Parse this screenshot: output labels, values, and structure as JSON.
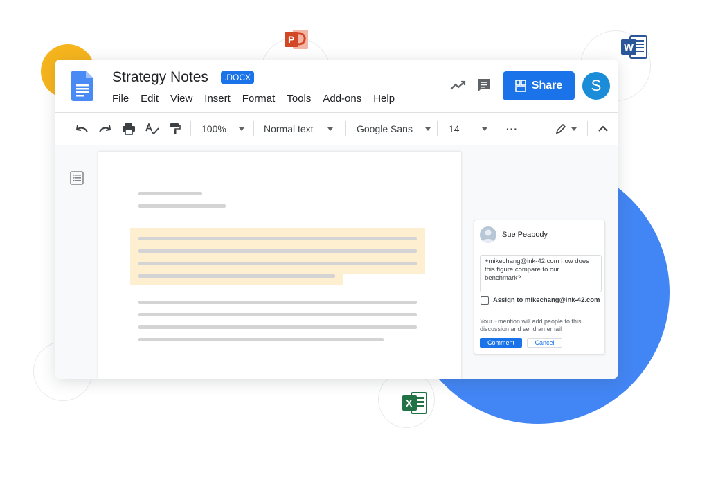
{
  "app": {
    "title": "Strategy Notes",
    "badge": ".DOCX",
    "menu": [
      "File",
      "Edit",
      "View",
      "Insert",
      "Format",
      "Tools",
      "Add-ons",
      "Help"
    ],
    "share_label": "Share",
    "avatar_initial": "S"
  },
  "toolbar": {
    "zoom": "100%",
    "style": "Normal text",
    "font": "Google Sans",
    "size": "14",
    "more": "···"
  },
  "comment": {
    "author": "Sue Peabody",
    "text": "+mikechang@ink-42.com how does this figure compare to our benchmark?",
    "assign_label": "Assign to mikechang@ink-42.com",
    "note": "Your +mention will add people to this discussion and send an email",
    "comment_button": "Comment",
    "cancel_button": "Cancel"
  },
  "deco_icons": {
    "powerpoint": "P",
    "word": "W",
    "excel": "X"
  },
  "colors": {
    "accent_blue": "#1a73e8",
    "circle_blue": "#4285f4",
    "circle_yellow": "#f6b51d",
    "highlight": "#fdefcf",
    "docs_blue": "#4a8af4",
    "ppt_red": "#d24726",
    "word_blue": "#2b579a",
    "excel_green": "#217346"
  }
}
